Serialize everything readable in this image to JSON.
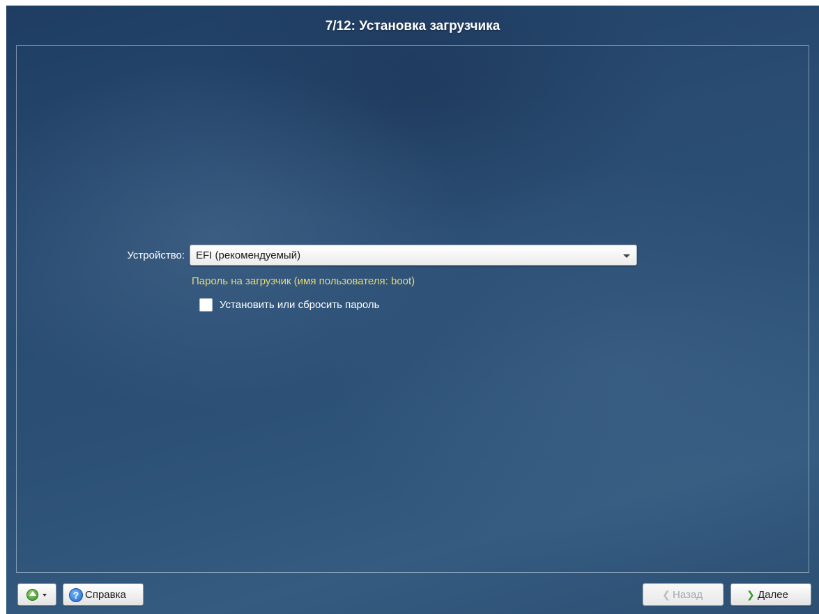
{
  "header": {
    "title": "7/12: Установка загрузчика"
  },
  "form": {
    "device_label": "Устройство:",
    "device_select": {
      "value": "EFI (рекомендуемый)"
    },
    "password_hint": "Пароль на загрузчик (имя пользователя: boot)",
    "password_checkbox": {
      "label": "Установить или сбросить пароль",
      "checked": false
    }
  },
  "footer": {
    "menu_icon": "green-up-arrow-icon",
    "help_label": "Справка",
    "help_icon": "question-mark-icon",
    "back_label": "Назад",
    "back_enabled": false,
    "next_label": "Далее"
  },
  "colors": {
    "background": "#2a4c72",
    "hint_text": "#e6d77a",
    "title_text": "#ffffff"
  }
}
